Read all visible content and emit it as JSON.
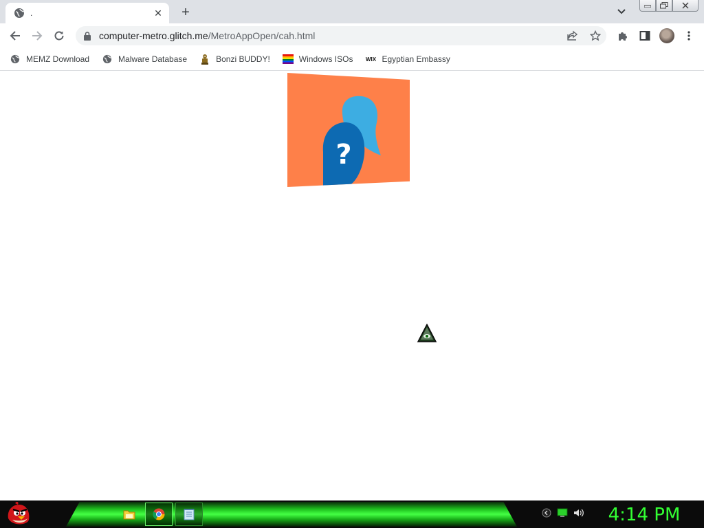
{
  "browser": {
    "tab": {
      "title": ".",
      "icon": "globe-icon"
    },
    "omnibox": {
      "host": "computer-metro.glitch.me",
      "path": "/MetroAppOpen/cah.html"
    },
    "bookmarks": [
      {
        "label": "MEMZ Download",
        "icon": "globe-icon"
      },
      {
        "label": "Malware Database",
        "icon": "globe-icon"
      },
      {
        "label": "Bonzi BUDDY!",
        "icon": "bonzi-icon"
      },
      {
        "label": "Windows ISOs",
        "icon": "windows-flag-icon"
      },
      {
        "label": "Egyptian Embassy",
        "icon": "wix-icon"
      }
    ],
    "wix_logo_text": "WIX"
  },
  "page": {
    "tile_background": "#fe8049",
    "tile_icon": "question-chat-bubbles-icon",
    "tile_glyph": "?"
  },
  "taskbar": {
    "clock": "4:14 PM",
    "accent": "#33ff33",
    "pinned": [
      {
        "name": "file-explorer",
        "icon": "folder-icon",
        "active": false
      },
      {
        "name": "chrome",
        "icon": "chrome-icon",
        "active": true
      },
      {
        "name": "notepad",
        "icon": "notepad-icon",
        "active": false
      }
    ]
  }
}
